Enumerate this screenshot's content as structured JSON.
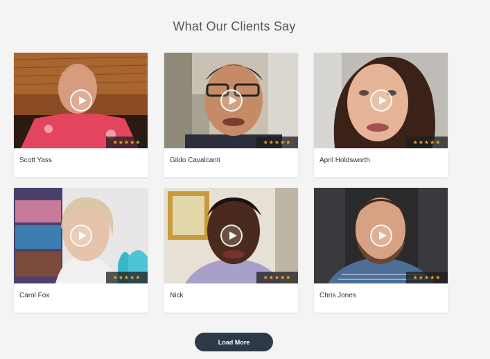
{
  "section": {
    "title": "What Our Clients Say"
  },
  "rating_glyph": "★★★★★",
  "testimonials": [
    {
      "name": "Scott Yass",
      "rating": 5
    },
    {
      "name": "Gildo Cavalcanti",
      "rating": 5
    },
    {
      "name": "April Holdsworth",
      "rating": 5
    },
    {
      "name": "Carol Fox",
      "rating": 5
    },
    {
      "name": "Nick",
      "rating": 5
    },
    {
      "name": "Chris Jones",
      "rating": 5
    }
  ],
  "load_more": {
    "label": "Load More",
    "color": "#2c3a48"
  },
  "colors": {
    "star": "#f4a62a",
    "background": "#f4f4f4"
  }
}
